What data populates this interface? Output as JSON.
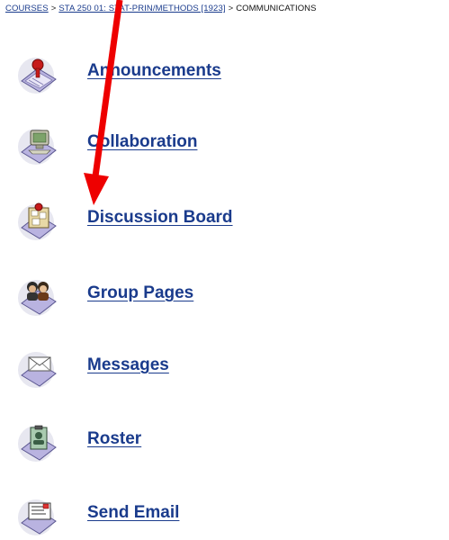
{
  "breadcrumb": {
    "courses": "COURSES",
    "separator": ">",
    "course": "STA 250 01: STAT-PRIN/METHODS [1923]",
    "current": "COMMUNICATIONS"
  },
  "menu": [
    {
      "label": "Announcements",
      "icon": "announcements-icon"
    },
    {
      "label": "Collaboration",
      "icon": "collaboration-icon"
    },
    {
      "label": "Discussion Board",
      "icon": "discussion-board-icon"
    },
    {
      "label": "Group Pages",
      "icon": "group-pages-icon"
    },
    {
      "label": "Messages",
      "icon": "messages-icon"
    },
    {
      "label": "Roster",
      "icon": "roster-icon"
    },
    {
      "label": "Send Email",
      "icon": "send-email-icon"
    }
  ],
  "colors": {
    "link": "#1a3b8c",
    "arrow": "#ee0000",
    "icon_base": "#b9b3e0"
  }
}
